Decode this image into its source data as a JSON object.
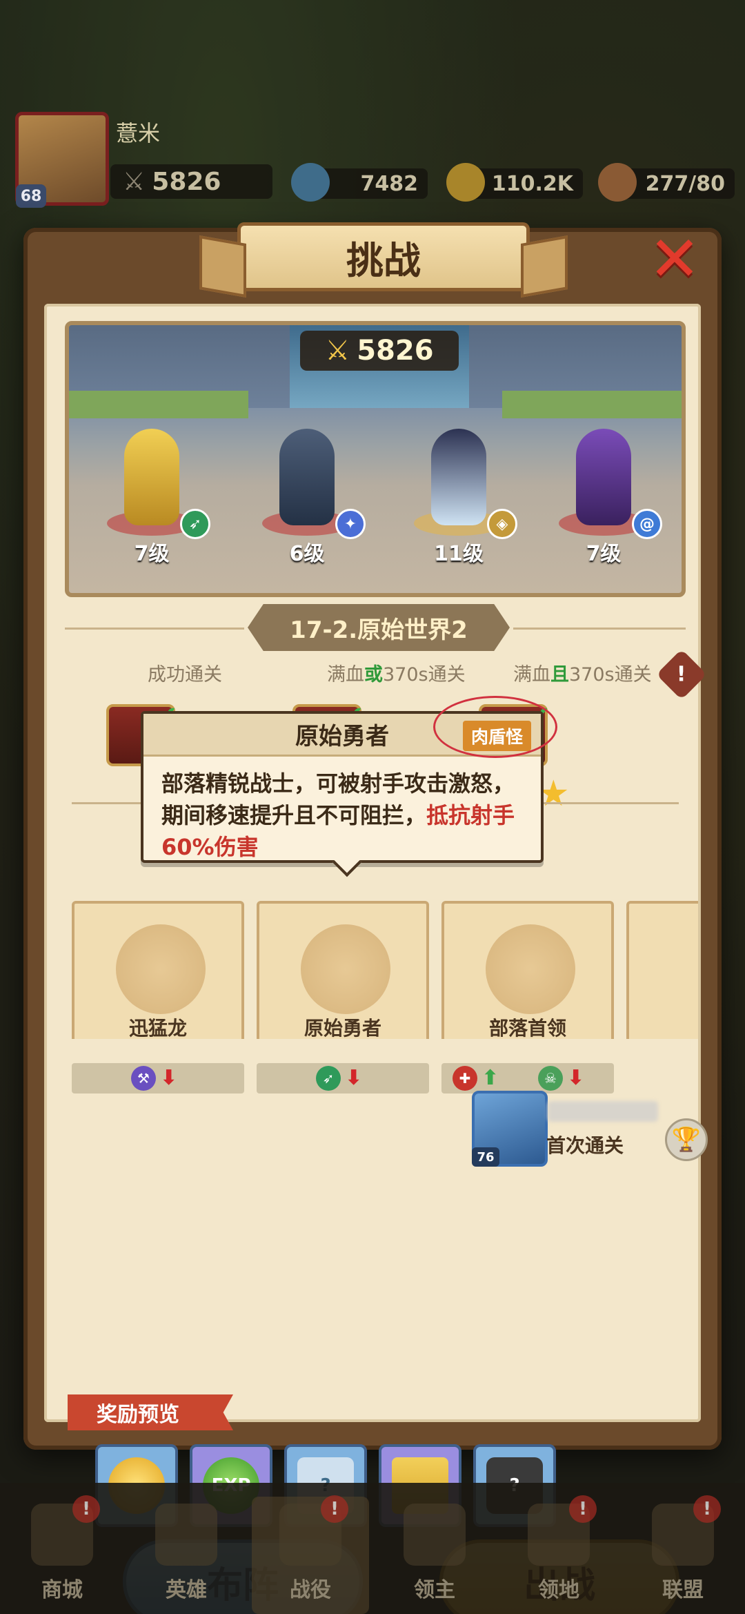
{
  "player": {
    "name": "薏米",
    "level": "68",
    "power": "5826"
  },
  "resources": {
    "gems": "7482",
    "gold": "110.2K",
    "stamina": "277/80"
  },
  "modal": {
    "title": "挑战",
    "close_label": "✕",
    "team_power": "5826",
    "heroes": [
      {
        "level": "7级",
        "class_icon": "bow-icon"
      },
      {
        "level": "6级",
        "class_icon": "paw-icon"
      },
      {
        "level": "11级",
        "class_icon": "shield-icon"
      },
      {
        "level": "7级",
        "class_icon": "swirl-icon"
      }
    ],
    "stage_name": "17-2.原始世界2",
    "conditions": {
      "c1": "成功通关",
      "c2_pre": "满血",
      "c2_mid": "或",
      "c2_post": "370s通关",
      "c3_pre": "满血",
      "c3_mid": "且",
      "c3_post": "370s通关"
    },
    "tooltip": {
      "title": "原始勇者",
      "tag": "肉盾怪",
      "desc_plain": "部落精锐战士，可被射手攻击激怒，期间移速提升且不可阻拦，",
      "desc_highlight": "抵抗射手60%伤害"
    },
    "enemies": [
      {
        "name": "迅猛龙"
      },
      {
        "name": "原始勇者"
      },
      {
        "name": "部落首领"
      }
    ],
    "first_clear": {
      "label": "首次通关",
      "level": "76"
    },
    "rewards_title": "奖励预览",
    "reward_exp_label": "EXP",
    "reward_unknown_label": "?",
    "formation_button": "布阵",
    "battle_button": "出战"
  },
  "nav": {
    "items": [
      "商城",
      "英雄",
      "战役",
      "领主",
      "领地",
      "联盟"
    ]
  },
  "colors": {
    "accent_red": "#c8352c",
    "success_green": "#2f9a3a",
    "formation_blue": "#3b8fd8",
    "battle_gold": "#f1b72b"
  }
}
